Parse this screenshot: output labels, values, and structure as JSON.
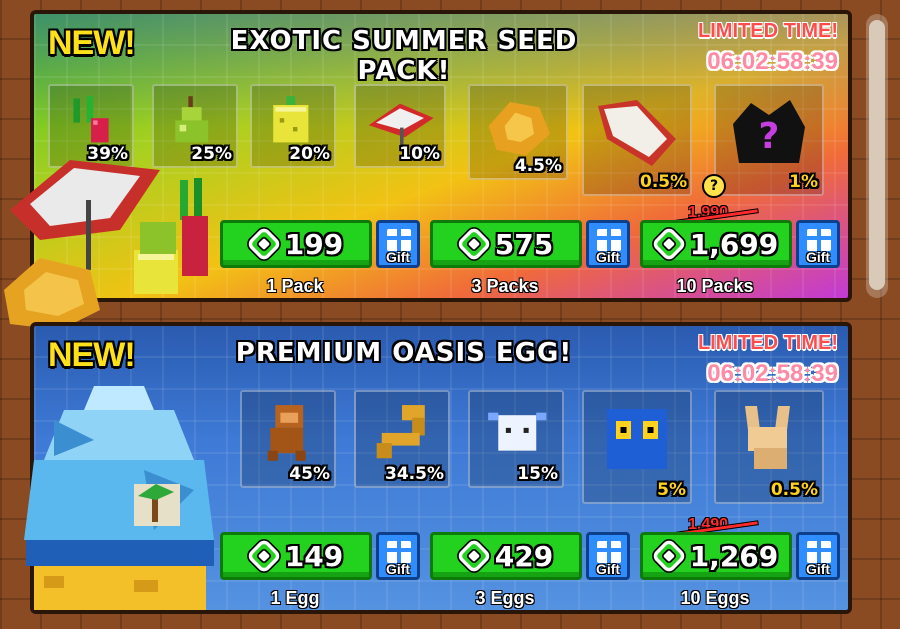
{
  "seed_pack": {
    "new_label": "NEW!",
    "title": "EXOTIC SUMMER SEED PACK!",
    "limited_label": "LIMITED TIME!",
    "timer": "06:02:58:39",
    "items": [
      {
        "name": "seed-item-1",
        "icon": "dragon-fruit-sprout",
        "chance": "39%"
      },
      {
        "name": "seed-item-2",
        "icon": "pear",
        "chance": "25%"
      },
      {
        "name": "seed-item-3",
        "icon": "yellow-cube-fruit",
        "chance": "20%"
      },
      {
        "name": "seed-item-4",
        "icon": "umbrella",
        "chance": "10%"
      },
      {
        "name": "seed-item-5",
        "icon": "golden-rose",
        "chance": "4.5%"
      },
      {
        "name": "seed-item-6",
        "icon": "white-leaf",
        "chance": "0.5%"
      },
      {
        "name": "seed-item-7",
        "icon": "mystery-plant",
        "chance": "1%"
      }
    ],
    "offers": [
      {
        "price": "199",
        "qty": "1 Pack",
        "old_price": ""
      },
      {
        "price": "575",
        "qty": "3 Packs",
        "old_price": ""
      },
      {
        "price": "1,699",
        "qty": "10 Packs",
        "old_price": "1,990"
      }
    ],
    "gift_label": "Gift",
    "question_mark": "?"
  },
  "oasis_egg": {
    "new_label": "NEW!",
    "title": "PREMIUM OASIS EGG!",
    "limited_label": "LIMITED TIME!",
    "timer": "06:02:58:39",
    "items": [
      {
        "name": "egg-item-1",
        "icon": "monkey",
        "chance": "45%"
      },
      {
        "name": "egg-item-2",
        "icon": "snake",
        "chance": "34.5%"
      },
      {
        "name": "egg-item-3",
        "icon": "axolotl",
        "chance": "15%"
      },
      {
        "name": "egg-item-4",
        "icon": "blue-owl",
        "chance": "5%"
      },
      {
        "name": "egg-item-5",
        "icon": "fennec-fox",
        "chance": "0.5%"
      }
    ],
    "offers": [
      {
        "price": "149",
        "qty": "1 Egg",
        "old_price": ""
      },
      {
        "price": "429",
        "qty": "3 Eggs",
        "old_price": ""
      },
      {
        "price": "1,269",
        "qty": "10 Eggs",
        "old_price": "1,490"
      }
    ],
    "gift_label": "Gift"
  },
  "colors": {
    "buy_green": "#22d21e",
    "gift_blue": "#2f8dff",
    "new_yellow": "#ffe11a",
    "limited_red": "#ff4d4d",
    "timer_pink": "#ff8aa6",
    "rare_gold": "#ffd21f"
  }
}
